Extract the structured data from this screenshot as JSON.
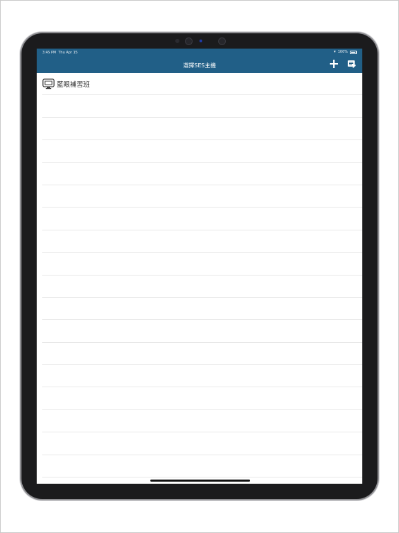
{
  "status_bar": {
    "time": "3:45 PM",
    "date": "Thu Apr 15",
    "wifi_icon": "wifi-icon",
    "battery_percent": "100%"
  },
  "nav": {
    "title": "選擇SES主機",
    "add_icon": "plus-icon",
    "edit_icon": "edit-list-icon"
  },
  "hosts": [
    {
      "label": "藍眼補習班",
      "icon": "monitor-icon"
    }
  ],
  "empty_rows": 17,
  "colors": {
    "header": "#215f87",
    "device_bezel": "#1b1b1d",
    "separator": "#e8e8e8"
  }
}
